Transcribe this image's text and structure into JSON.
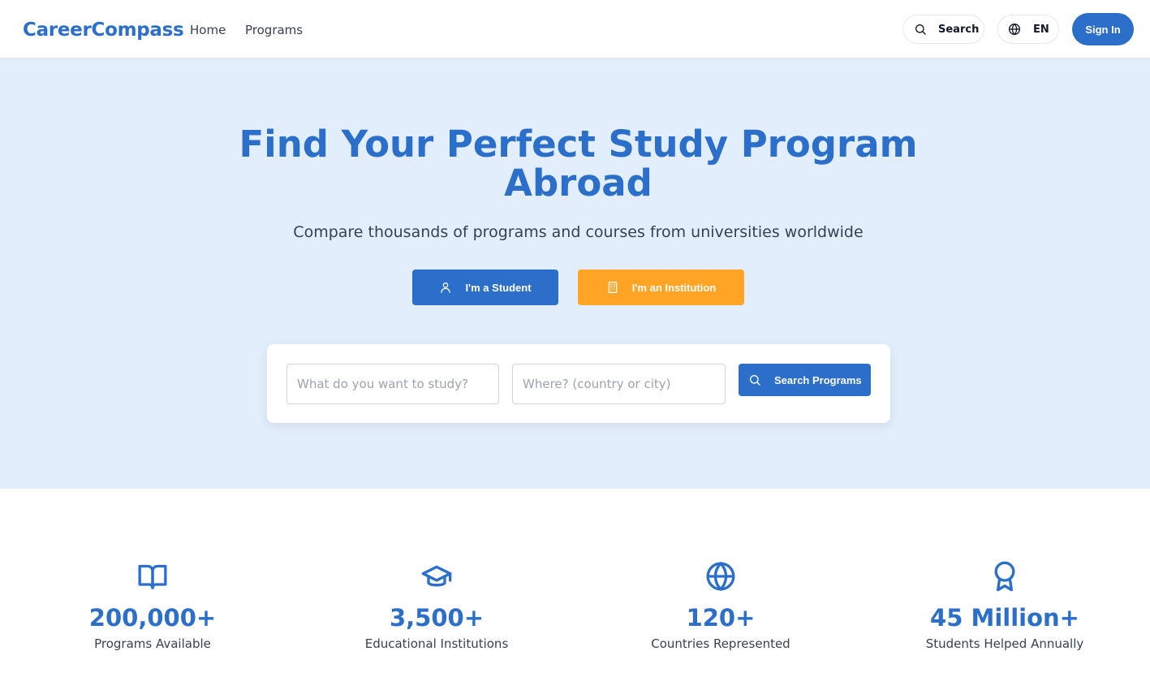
{
  "header": {
    "logo": "CareerCompass",
    "nav": [
      "Home",
      "Programs"
    ],
    "search_label": "Search",
    "language": "EN",
    "signin_label": "Sign In"
  },
  "hero": {
    "title_line1": "Find Your Perfect Study Program",
    "title_line2": "Abroad",
    "subtitle": "Compare thousands of programs and courses from universities worldwide",
    "student_button": "I'm a Student",
    "institution_button": "I'm an Institution"
  },
  "search": {
    "what_placeholder": "What do you want to study?",
    "where_placeholder": "Where? (country or city)",
    "what_value": "",
    "where_value": "",
    "button_label": "Search Programs"
  },
  "stats": [
    {
      "icon": "book-open-icon",
      "value": "200,000+",
      "label": "Programs Available"
    },
    {
      "icon": "graduation-cap-icon",
      "value": "3,500+",
      "label": "Educational Institutions"
    },
    {
      "icon": "globe-icon",
      "value": "120+",
      "label": "Countries Represented"
    },
    {
      "icon": "award-icon",
      "value": "45 Million+",
      "label": "Students Helped Annually"
    }
  ],
  "colors": {
    "brand": "#2b6fcb",
    "accent": "#ffa424",
    "hero_bg": "#e2eefc"
  }
}
